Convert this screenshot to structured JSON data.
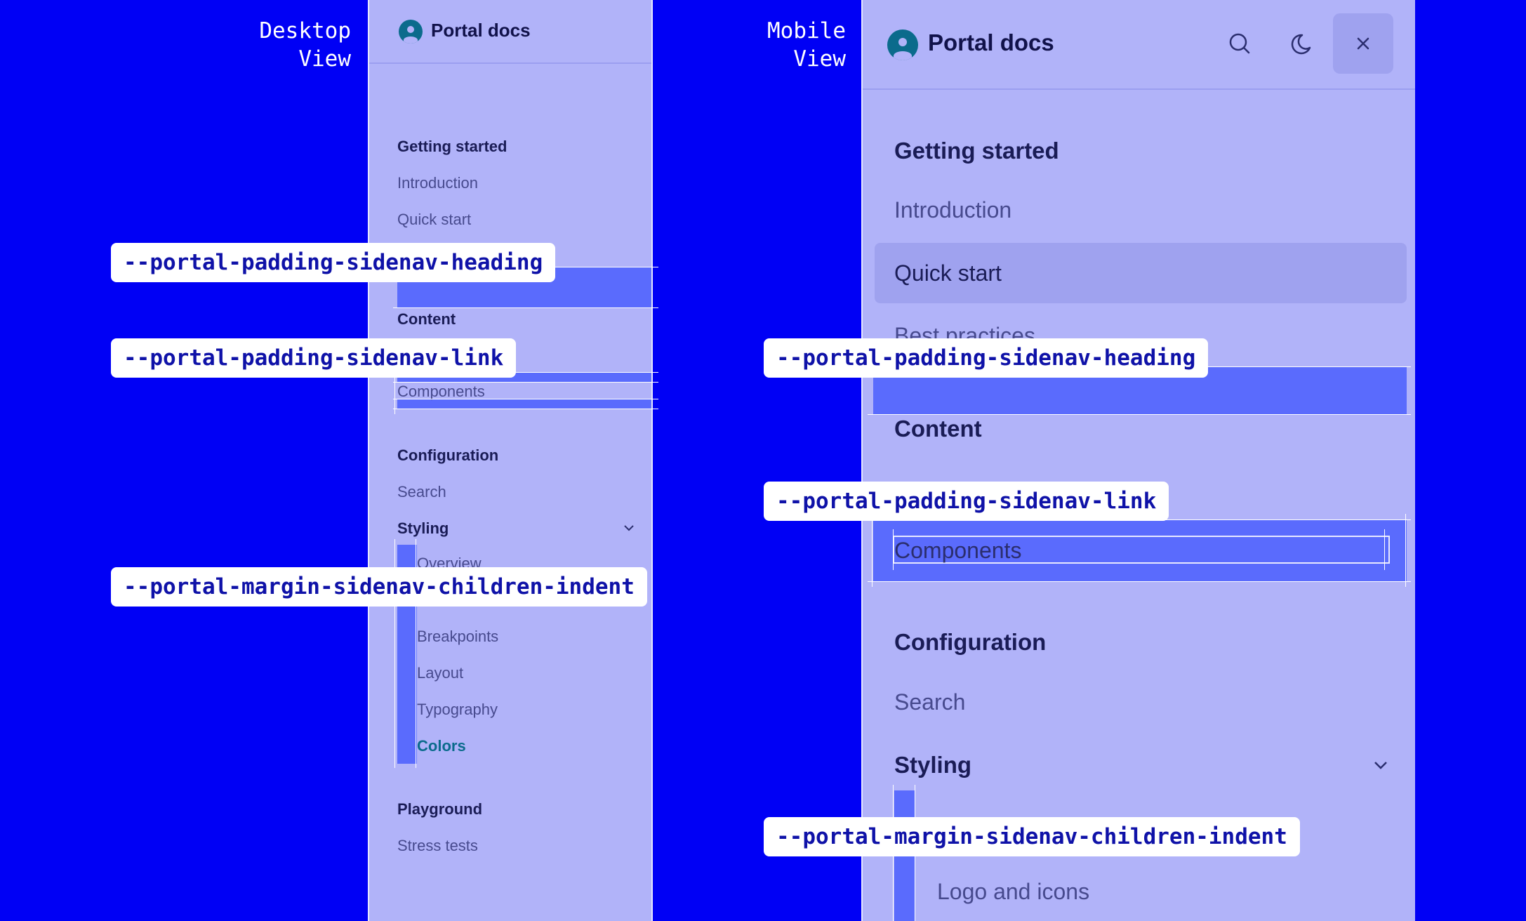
{
  "views": {
    "desktop_title_line1": "Desktop",
    "desktop_title_line2": "View",
    "mobile_title_line1": "Mobile",
    "mobile_title_line2": "View"
  },
  "brand": "Portal docs",
  "desktop": {
    "sections": [
      {
        "heading": "Getting started",
        "links": [
          "Introduction",
          "Quick start"
        ]
      },
      {
        "heading": "Content",
        "links": [
          "Components"
        ]
      },
      {
        "heading": "Configuration",
        "links": [
          "Search"
        ]
      },
      {
        "heading": "Styling",
        "children": [
          "Overview",
          "Breakpoints",
          "Layout",
          "Typography",
          "Colors"
        ]
      },
      {
        "heading": "Playground",
        "links": [
          "Stress tests"
        ]
      }
    ],
    "active_child": "Colors"
  },
  "mobile": {
    "sections": [
      {
        "heading": "Getting started",
        "links": [
          "Introduction",
          "Quick start",
          "Best practices"
        ]
      },
      {
        "heading": "Content",
        "links": [
          "Components"
        ]
      },
      {
        "heading": "Configuration",
        "links": [
          "Search"
        ]
      },
      {
        "heading": "Styling",
        "children": [
          "Logo and icons"
        ]
      }
    ],
    "selected_link": "Quick start"
  },
  "labels": {
    "heading_padding": "--portal-padding-sidenav-heading",
    "link_padding": "--portal-padding-sidenav-link",
    "children_indent": "--portal-margin-sidenav-children-indent"
  },
  "icons": {
    "logo": "portal-logo-icon",
    "search": "search-icon",
    "theme": "moon-icon",
    "close": "close-icon",
    "chevron": "chevron-down-icon"
  },
  "colors": {
    "background": "#0000f5",
    "panel": "#b1b3f9",
    "highlight": "#5a6bfd",
    "active_link": "#0b6b8c",
    "label_text": "#0f12a8"
  }
}
